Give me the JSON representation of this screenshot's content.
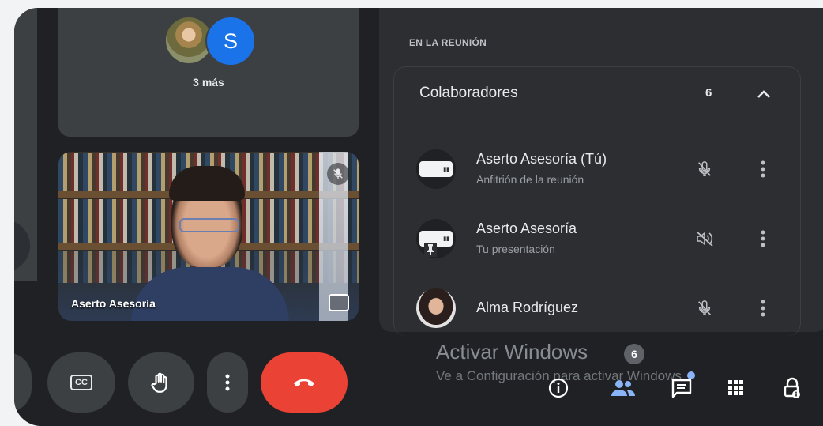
{
  "grid": {
    "others_avatar_letter": "S",
    "others_label": "3 más"
  },
  "self_tile": {
    "name": "Aserto Asesoría",
    "mic_state": "muted"
  },
  "controls": {
    "captions_label": "CC"
  },
  "panel": {
    "heading": "EN LA REUNIÓN",
    "group": {
      "title": "Colaboradores",
      "count": "6",
      "expanded": true
    },
    "participants": [
      {
        "name": "Aserto Asesoría (Tú)",
        "subtitle": "Anfitrión de la reunión",
        "avatar": "logo",
        "mic": "muted"
      },
      {
        "name": "Aserto Asesoría",
        "subtitle": "Tu presentación",
        "avatar": "logo-pin",
        "mic": "audio-off"
      },
      {
        "name": "Alma Rodríguez",
        "subtitle": "",
        "avatar": "photo",
        "mic": "muted"
      }
    ]
  },
  "watermark": {
    "title": "Activar Windows",
    "subtitle": "Ve a Configuración para activar Windows.",
    "participants_badge": "6"
  },
  "colors": {
    "background": "#202124",
    "panel": "#2d2e31",
    "tile": "#3c4043",
    "accent_blue": "#1a73e8",
    "leave_red": "#ea4335",
    "people_active": "#8ab4f8"
  },
  "icons": [
    "mic-off-icon",
    "more-vert-icon",
    "chevron-up-icon",
    "hand-icon",
    "call-end-icon",
    "info-icon",
    "people-icon",
    "chat-icon",
    "apps-icon",
    "lock-icon",
    "pin-icon",
    "pip-icon"
  ]
}
